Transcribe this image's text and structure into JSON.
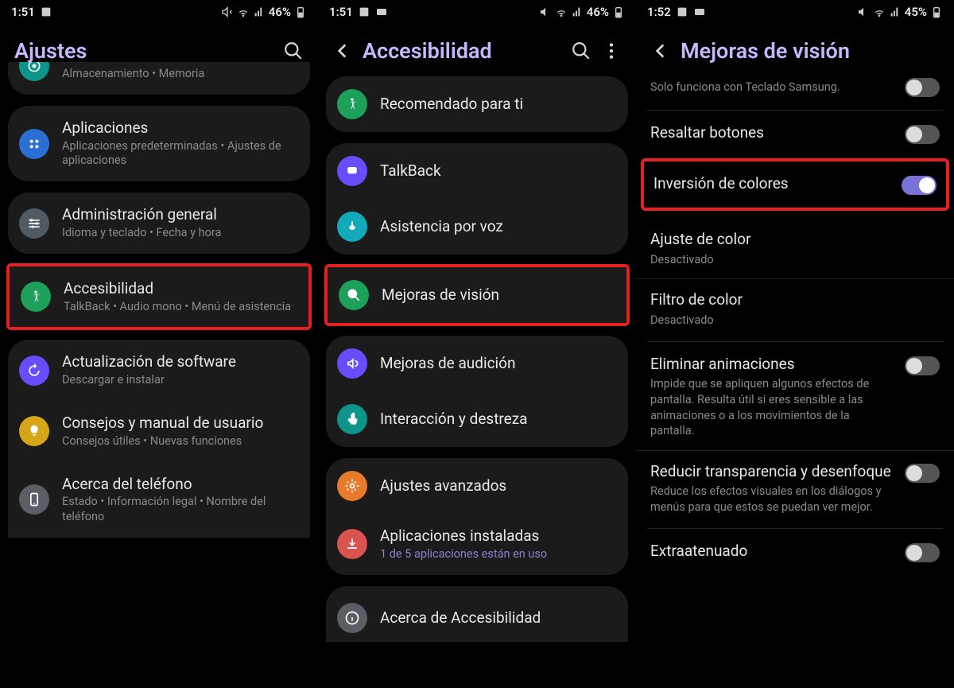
{
  "screens": [
    {
      "status": {
        "time": "1:51",
        "battery": "46%"
      },
      "header": {
        "title": "Ajustes",
        "has_back": false,
        "has_search": true,
        "has_more": false
      },
      "groups": [
        {
          "clip": "top",
          "rows": [
            {
              "icon": "storage",
              "bg": "bg-teal",
              "title": "",
              "sub": "Almacenamiento  •  Memoria"
            }
          ]
        },
        {
          "rows": [
            {
              "icon": "apps",
              "bg": "bg-blue",
              "title": "Aplicaciones",
              "sub": "Aplicaciones predeterminadas  •  Ajustes de aplicaciones"
            }
          ]
        },
        {
          "rows": [
            {
              "icon": "sliders",
              "bg": "bg-grey",
              "title": "Administración general",
              "sub": "Idioma y teclado  •  Fecha y hora"
            },
            {
              "highlight": true,
              "icon": "a11y",
              "bg": "bg-green",
              "title": "Accesibilidad",
              "sub": "TalkBack  •  Audio mono  •  Menú de asistencia"
            },
            {
              "icon": "update",
              "bg": "bg-purple",
              "title": "Actualización de software",
              "sub": "Descargar e instalar"
            },
            {
              "icon": "bulb",
              "bg": "bg-yellow",
              "title": "Consejos y manual de usuario",
              "sub": "Consejos útiles  •  Nuevas funciones"
            },
            {
              "icon": "phone",
              "bg": "bg-greydk",
              "title": "Acerca del teléfono",
              "sub": "Estado  •  Información legal  •  Nombre del teléfono"
            }
          ],
          "clipend": "bottom"
        }
      ]
    },
    {
      "status": {
        "time": "1:51",
        "battery": "46%",
        "extra_img": true
      },
      "header": {
        "title": "Accesibilidad",
        "has_back": true,
        "has_search": true,
        "has_more": true
      },
      "groups": [
        {
          "rows": [
            {
              "icon": "a11y",
              "bg": "bg-green",
              "title": "Recomendado para ti"
            }
          ]
        },
        {
          "rows": [
            {
              "icon": "talkback",
              "bg": "bg-violet",
              "title": "TalkBack"
            },
            {
              "icon": "voice",
              "bg": "bg-cyan",
              "title": "Asistencia por voz"
            },
            {
              "highlight": true,
              "icon": "zoom",
              "bg": "bg-green",
              "title": "Mejoras de visión"
            },
            {
              "icon": "hearing",
              "bg": "bg-violet",
              "title": "Mejoras de audición"
            },
            {
              "icon": "touch",
              "bg": "bg-teal",
              "title": "Interacción y destreza"
            }
          ]
        },
        {
          "rows": [
            {
              "icon": "gear",
              "bg": "bg-orange",
              "title": "Ajustes avanzados"
            },
            {
              "icon": "download",
              "bg": "bg-red",
              "title": "Aplicaciones instaladas",
              "sub": "1 de 5 aplicaciones están en uso",
              "sub_accent": true
            }
          ]
        },
        {
          "rows": [
            {
              "icon": "info",
              "bg": "bg-info",
              "title": "Acerca de Accesibilidad"
            }
          ],
          "clipend": "bottom"
        }
      ]
    },
    {
      "status": {
        "time": "1:52",
        "battery": "45%",
        "extra_img": true
      },
      "header": {
        "title": "Mejoras de visión",
        "has_back": true,
        "has_search": false,
        "has_more": false
      },
      "toggle_rows": [
        {
          "title": "",
          "sub": "Solo funciona con Teclado Samsung.",
          "toggle": false,
          "sep_after": true,
          "clip": "top"
        },
        {
          "title": "Resaltar botones",
          "toggle": false
        },
        {
          "highlight": true,
          "title": "Inversión de colores",
          "toggle": true
        },
        {
          "title": "Ajuste de color",
          "sub": "Desactivado",
          "sep_before": true
        },
        {
          "title": "Filtro de color",
          "sub": "Desactivado",
          "sep_after": true
        },
        {
          "title": "Eliminar animaciones",
          "sub": "Impide que se apliquen algunos efectos de pantalla. Resulta útil si eres sensible a las animaciones o a los movimientos de la pantalla.",
          "toggle": false
        },
        {
          "title": "Reducir transparencia y desenfoque",
          "sub": "Reduce los efectos visuales en los diálogos y menús para que estos se puedan ver mejor.",
          "toggle": false,
          "sep_after": true
        },
        {
          "title": "Extraatenuado",
          "toggle": false,
          "clip": "bottom"
        }
      ]
    }
  ],
  "icons": {
    "storage": "storage-icon",
    "apps": "apps-icon",
    "sliders": "sliders-icon",
    "a11y": "accessibility-icon",
    "update": "update-icon",
    "bulb": "bulb-icon",
    "phone": "phone-icon",
    "talkback": "talkback-icon",
    "voice": "voice-icon",
    "zoom": "zoom-icon",
    "hearing": "hearing-icon",
    "touch": "touch-icon",
    "gear": "gear-icon",
    "download": "download-icon",
    "info": "info-icon"
  }
}
